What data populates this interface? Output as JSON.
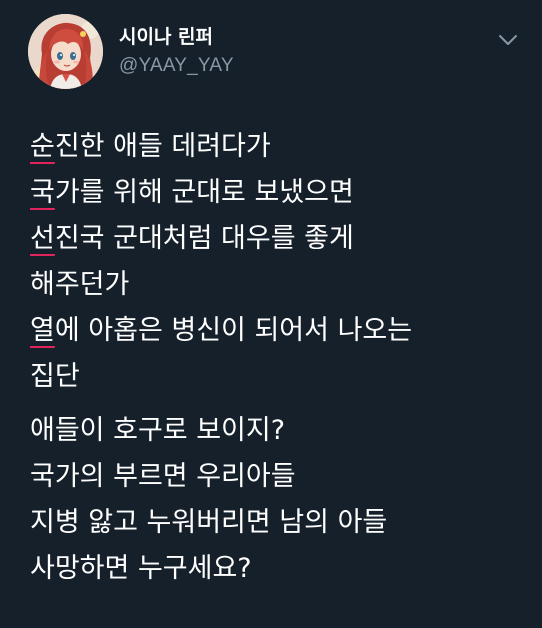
{
  "tweet": {
    "display_name": "시이나 린퍼",
    "handle": "@YAAY_YAY",
    "avatar": {
      "icon": "anime-girl-avatar-icon",
      "colors": {
        "hair": "#c7473a",
        "skin": "#f6dccb",
        "background": "#ead8cc"
      }
    },
    "more_icon": "chevron-down-icon",
    "accent_underline_color": "#e0245e",
    "paragraphs": [
      {
        "lines": [
          {
            "marked": "순",
            "rest": "진한 애들 데려다가"
          },
          {
            "marked": "국",
            "rest": "가를 위해 군대로 보냈으면"
          },
          {
            "marked": "선",
            "rest": "진국 군대처럼 대우를 좋게"
          },
          {
            "marked": "",
            "rest": "해주던가"
          },
          {
            "marked": "열",
            "rest": "에 아홉은 병신이 되어서 나오는"
          },
          {
            "marked": "",
            "rest": "집단"
          }
        ]
      },
      {
        "lines": [
          {
            "marked": "",
            "rest": "애들이 호구로 보이지?"
          },
          {
            "marked": "",
            "rest": "국가의 부르면 우리아들"
          },
          {
            "marked": "",
            "rest": "지병 앓고 누워버리면 남의 아들"
          },
          {
            "marked": "",
            "rest": "사망하면 누구세요?"
          }
        ]
      }
    ]
  },
  "colors": {
    "background": "#15202b",
    "text": "#ffffff",
    "secondary_text": "#8899a6"
  }
}
